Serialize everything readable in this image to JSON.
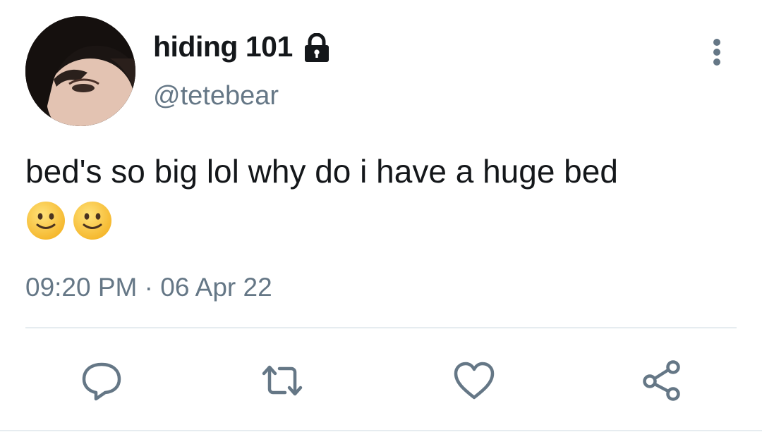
{
  "tweet": {
    "display_name": "hiding 101",
    "handle": "@tetebear",
    "text": "bed's so big lol why do i have a huge bed",
    "emojis": [
      "slightly-smiling-face-emoji",
      "slightly-smiling-face-emoji"
    ],
    "time": "09:20 PM",
    "separator": "·",
    "date": "06 Apr 22",
    "timestamp_text": "09:20 PM · 06 Apr 22",
    "protected_icon": "lock-icon",
    "menu_icon": "more-vertical-icon"
  },
  "actions": [
    {
      "icon": "reply-icon"
    },
    {
      "icon": "retweet-icon"
    },
    {
      "icon": "like-icon"
    },
    {
      "icon": "share-icon"
    }
  ],
  "colors": {
    "text_primary": "#14171a",
    "text_secondary": "#657786",
    "icon": "#657786",
    "divider": "#e6ecf0",
    "emoji_face": "#ffcc4d"
  }
}
